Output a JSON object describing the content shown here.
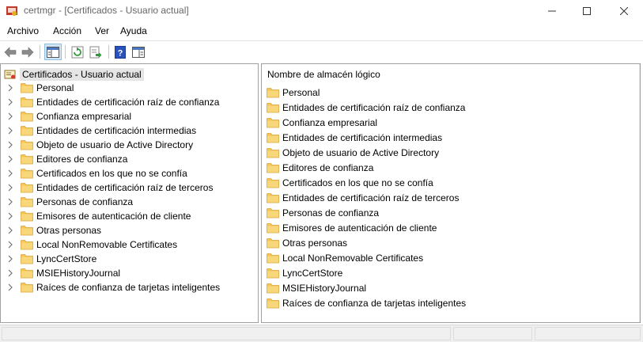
{
  "window": {
    "title": "certmgr - [Certificados - Usuario actual]"
  },
  "menu": {
    "items": [
      "Archivo",
      "Acción",
      "Ver",
      "Ayuda"
    ]
  },
  "toolbar": {
    "buttons": [
      "back-icon",
      "forward-icon",
      "console-tree-icon",
      "refresh-icon",
      "export-list-icon",
      "help-icon",
      "properties-icon"
    ]
  },
  "tree": {
    "root": "Certificados - Usuario actual",
    "items": [
      "Personal",
      "Entidades de certificación raíz de confianza",
      "Confianza empresarial",
      "Entidades de certificación intermedias",
      "Objeto de usuario de Active Directory",
      "Editores de confianza",
      "Certificados en los que no se confía",
      "Entidades de certificación raíz de terceros",
      "Personas de confianza",
      "Emisores de autenticación de cliente",
      "Otras personas",
      "Local NonRemovable Certificates",
      "LyncCertStore",
      "MSIEHistoryJournal",
      "Raíces de confianza de tarjetas inteligentes"
    ]
  },
  "list": {
    "column_header": "Nombre de almacén lógico",
    "items": [
      "Personal",
      "Entidades de certificación raíz de confianza",
      "Confianza empresarial",
      "Entidades de certificación intermedias",
      "Objeto de usuario de Active Directory",
      "Editores de confianza",
      "Certificados en los que no se confía",
      "Entidades de certificación raíz de terceros",
      "Personas de confianza",
      "Emisores de autenticación de cliente",
      "Otras personas",
      "Local NonRemovable Certificates",
      "LyncCertStore",
      "MSIEHistoryJournal",
      "Raíces de confianza de tarjetas inteligentes"
    ]
  },
  "colors": {
    "folder": "#f4c55a",
    "folder_dark": "#d9a43a",
    "selection": "#e5e5e5",
    "toolbar_active": "#cde6f7"
  }
}
